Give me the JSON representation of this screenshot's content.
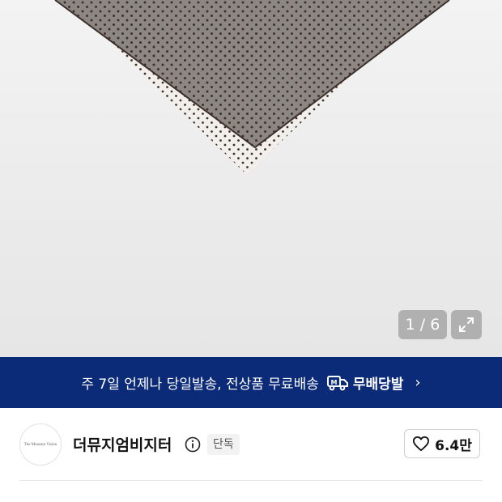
{
  "gallery": {
    "counter": "1 / 6",
    "colors": {
      "scarf": "#8f8985",
      "border": "#f3f1ee",
      "dots": "#4a3a36"
    }
  },
  "banner": {
    "text": "주 7일 언제나 당일발송, 전상품 무료배송",
    "brand_label": "무배당발",
    "chevron": "›",
    "background": "#0b2a77"
  },
  "seller": {
    "avatar_text": "The Museum Vision",
    "name": "더뮤지엄비지터",
    "badge": "단독",
    "likes": "6.4만"
  },
  "icons": [
    "expand-icon",
    "truck-icon",
    "info-icon",
    "heart-icon",
    "chevron-right-icon"
  ]
}
